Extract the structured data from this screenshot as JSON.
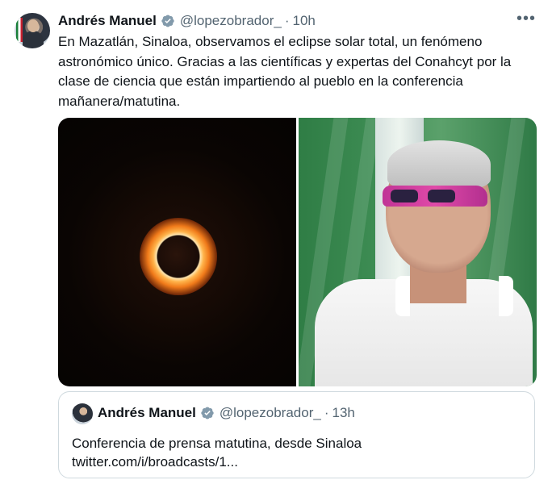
{
  "tweet": {
    "author_name": "Andrés Manuel",
    "handle": "@lopezobrador_",
    "separator": "·",
    "time": "10h",
    "more_label": "•••",
    "text": "En Mazatlán, Sinaloa, observamos el eclipse solar total, un fenómeno astronómico único. Gracias a las científicas y expertas del Conahcyt por la clase de ciencia que están impartiendo al pueblo en la conferencia mañanera/matutina."
  },
  "quoted_tweet": {
    "author_name": "Andrés Manuel",
    "handle": "@lopezobrador_",
    "separator": "·",
    "time": "13h",
    "line1": "Conferencia de prensa matutina, desde Sinaloa",
    "line2": "twitter.com/i/broadcasts/1..."
  },
  "icons": {
    "verified": "verified-badge-icon",
    "more": "more-options-icon"
  },
  "colors": {
    "text_primary": "#0f1419",
    "text_secondary": "#536471",
    "verified_badge": "#829aab",
    "border": "#cfd9de"
  }
}
